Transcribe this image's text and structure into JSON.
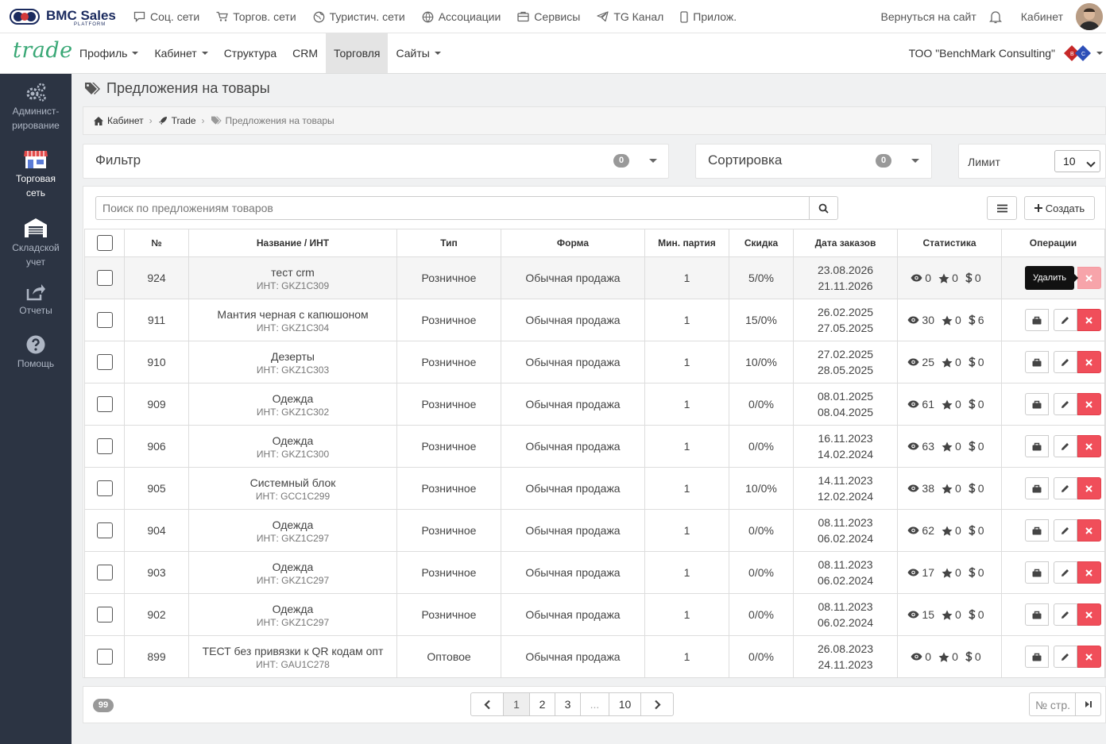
{
  "topbar": {
    "brand": "BMC Sales",
    "brand_sub": "PLATFORM",
    "items": [
      {
        "label": "Соц. сети",
        "icon": "chat-icon"
      },
      {
        "label": "Торгов. сети",
        "icon": "cart-icon"
      },
      {
        "label": "Туристич. сети",
        "icon": "globe-icon"
      },
      {
        "label": "Ассоциации",
        "icon": "network-icon"
      },
      {
        "label": "Сервисы",
        "icon": "box-icon"
      },
      {
        "label": "TG Канал",
        "icon": "telegram-icon"
      },
      {
        "label": "Прилож.",
        "icon": "phone-icon"
      }
    ],
    "back_to_site": "Вернуться на сайт",
    "cabinet": "Кабинет"
  },
  "navbar": {
    "brand": "trade",
    "menu": [
      {
        "label": "Профиль",
        "dropdown": true
      },
      {
        "label": "Кабинет",
        "dropdown": true
      },
      {
        "label": "Структура",
        "dropdown": false
      },
      {
        "label": "CRM",
        "dropdown": false
      },
      {
        "label": "Торговля",
        "dropdown": false,
        "active": true
      },
      {
        "label": "Сайты",
        "dropdown": true
      }
    ],
    "company": "ТОО \"BenchMark Consulting\""
  },
  "sidebar": {
    "items": [
      {
        "label": "Админист-рирование",
        "icon": "gears-icon"
      },
      {
        "label": "Торговая сеть",
        "icon": "store-icon",
        "active": true
      },
      {
        "label": "Складской учет",
        "icon": "warehouse-icon"
      },
      {
        "label": "Отчеты",
        "icon": "share-icon"
      },
      {
        "label": "Помощь",
        "icon": "help-icon"
      }
    ]
  },
  "page": {
    "title": "Предложения на товары",
    "breadcrumb": [
      "Кабинет",
      "Trade",
      "Предложения на товары"
    ]
  },
  "filter": {
    "title": "Фильтр",
    "count": "0"
  },
  "sort": {
    "title": "Сортировка",
    "count": "0"
  },
  "limit": {
    "label": "Лимит",
    "value": "10"
  },
  "search": {
    "placeholder": "Поиск по предложениям товаров"
  },
  "create_label": "Создать",
  "table": {
    "headers": [
      "№",
      "Название / ИНТ",
      "Тип",
      "Форма",
      "Мин. партия",
      "Скидка",
      "Дата заказов",
      "Статистика",
      "Операции"
    ],
    "rows": [
      {
        "id": "924",
        "name": "тест crm",
        "inn": "ИНТ: GKZ1C309",
        "type": "Розничное",
        "form": "Обычная продажа",
        "min": "1",
        "discount": "5/0%",
        "d1": "23.08.2026",
        "d2": "21.11.2026",
        "views": "0",
        "stars": "0",
        "money": "0"
      },
      {
        "id": "911",
        "name": "Мантия черная с капюшоном",
        "inn": "ИНТ: GKZ1C304",
        "type": "Розничное",
        "form": "Обычная продажа",
        "min": "1",
        "discount": "15/0%",
        "d1": "26.02.2025",
        "d2": "27.05.2025",
        "views": "30",
        "stars": "0",
        "money": "6"
      },
      {
        "id": "910",
        "name": "Дезерты",
        "inn": "ИНТ: GKZ1C303",
        "type": "Розничное",
        "form": "Обычная продажа",
        "min": "1",
        "discount": "10/0%",
        "d1": "27.02.2025",
        "d2": "28.05.2025",
        "views": "25",
        "stars": "0",
        "money": "0"
      },
      {
        "id": "909",
        "name": "Одежда",
        "inn": "ИНТ: GKZ1C302",
        "type": "Розничное",
        "form": "Обычная продажа",
        "min": "1",
        "discount": "0/0%",
        "d1": "08.01.2025",
        "d2": "08.04.2025",
        "views": "61",
        "stars": "0",
        "money": "0"
      },
      {
        "id": "906",
        "name": "Одежда",
        "inn": "ИНТ: GKZ1C300",
        "type": "Розничное",
        "form": "Обычная продажа",
        "min": "1",
        "discount": "0/0%",
        "d1": "16.11.2023",
        "d2": "14.02.2024",
        "views": "63",
        "stars": "0",
        "money": "0"
      },
      {
        "id": "905",
        "name": "Системный блок",
        "inn": "ИНТ: GCC1C299",
        "type": "Розничное",
        "form": "Обычная продажа",
        "min": "1",
        "discount": "10/0%",
        "d1": "14.11.2023",
        "d2": "12.02.2024",
        "views": "38",
        "stars": "0",
        "money": "0"
      },
      {
        "id": "904",
        "name": "Одежда",
        "inn": "ИНТ: GKZ1C297",
        "type": "Розничное",
        "form": "Обычная продажа",
        "min": "1",
        "discount": "0/0%",
        "d1": "08.11.2023",
        "d2": "06.02.2024",
        "views": "62",
        "stars": "0",
        "money": "0"
      },
      {
        "id": "903",
        "name": "Одежда",
        "inn": "ИНТ: GKZ1C297",
        "type": "Розничное",
        "form": "Обычная продажа",
        "min": "1",
        "discount": "0/0%",
        "d1": "08.11.2023",
        "d2": "06.02.2024",
        "views": "17",
        "stars": "0",
        "money": "0"
      },
      {
        "id": "902",
        "name": "Одежда",
        "inn": "ИНТ: GKZ1C297",
        "type": "Розничное",
        "form": "Обычная продажа",
        "min": "1",
        "discount": "0/0%",
        "d1": "08.11.2023",
        "d2": "06.02.2024",
        "views": "15",
        "stars": "0",
        "money": "0"
      },
      {
        "id": "899",
        "name": "ТЕСТ без привязки к QR кодам опт",
        "inn": "ИНТ: GAU1C278",
        "type": "Оптовое",
        "form": "Обычная продажа",
        "min": "1",
        "discount": "0/0%",
        "d1": "26.08.2023",
        "d2": "24.11.2023",
        "views": "0",
        "stars": "0",
        "money": "0"
      }
    ]
  },
  "tooltip": "Удалить",
  "footer": {
    "total": "99",
    "pages": [
      "1",
      "2",
      "3",
      "...",
      "10"
    ],
    "page_input_placeholder": "№ стр."
  },
  "colors": {
    "accent_green": "#3aa876",
    "sidebar": "#2c3443",
    "danger": "#f04e5a"
  }
}
